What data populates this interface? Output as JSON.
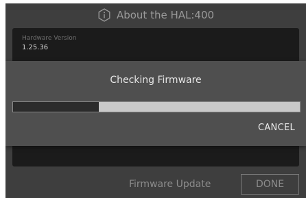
{
  "header": {
    "title": "About the HAL:400",
    "icon": "info-icon"
  },
  "info": {
    "hardware_version_label": "Hardware Version",
    "hardware_version_value": "1.25.36"
  },
  "dialog": {
    "title": "Checking Firmware",
    "progress": 0.3,
    "cancel_label": "CANCEL"
  },
  "footer": {
    "firmware_update_label": "Firmware Update",
    "done_label": "DONE"
  },
  "colors": {
    "screen_bg": "#3e3e3e",
    "panel_bg": "#1b1b1b",
    "dialog_bg": "#4f4f4f",
    "progress_fill": "#2b2b2b",
    "progress_track": "#c9c9c9"
  }
}
